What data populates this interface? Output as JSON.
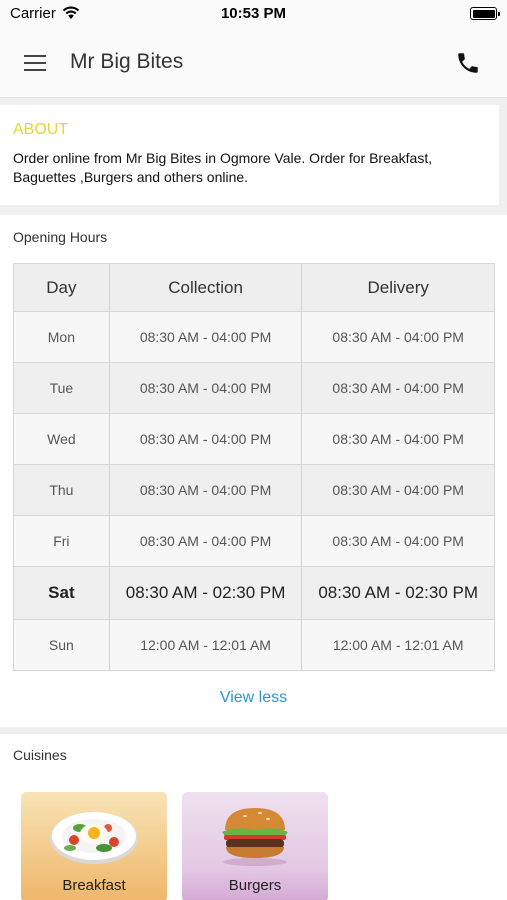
{
  "status": {
    "carrier": "Carrier",
    "time": "10:53 PM"
  },
  "header": {
    "title": "Mr Big Bites"
  },
  "about": {
    "title": "ABOUT",
    "text": "Order online from Mr Big Bites  in Ogmore Vale. Order for  Breakfast, Baguettes ,Burgers  and others online."
  },
  "hours": {
    "title": "Opening Hours",
    "columns": [
      "Day",
      "Collection",
      "Delivery"
    ],
    "rows": [
      {
        "day": "Mon",
        "collection": "08:30 AM - 04:00 PM",
        "delivery": "08:30 AM - 04:00 PM"
      },
      {
        "day": "Tue",
        "collection": "08:30 AM - 04:00 PM",
        "delivery": "08:30 AM - 04:00 PM"
      },
      {
        "day": "Wed",
        "collection": "08:30 AM - 04:00 PM",
        "delivery": "08:30 AM - 04:00 PM"
      },
      {
        "day": "Thu",
        "collection": "08:30 AM - 04:00 PM",
        "delivery": "08:30 AM - 04:00 PM"
      },
      {
        "day": "Fri",
        "collection": "08:30 AM - 04:00 PM",
        "delivery": "08:30 AM - 04:00 PM"
      },
      {
        "day": "Sat",
        "collection": "08:30 AM - 02:30 PM",
        "delivery": "08:30 AM - 02:30 PM"
      },
      {
        "day": "Sun",
        "collection": "12:00 AM - 12:01 AM",
        "delivery": "12:00 AM - 12:01 AM"
      }
    ],
    "view_less": "View less"
  },
  "cuisines": {
    "title": "Cuisines",
    "items": [
      {
        "label": "Breakfast",
        "icon": "breakfast-plate-icon"
      },
      {
        "label": "Burgers",
        "icon": "burger-icon"
      }
    ]
  },
  "colors": {
    "accent_about": "#e8d33a",
    "link": "#2a96c8"
  }
}
